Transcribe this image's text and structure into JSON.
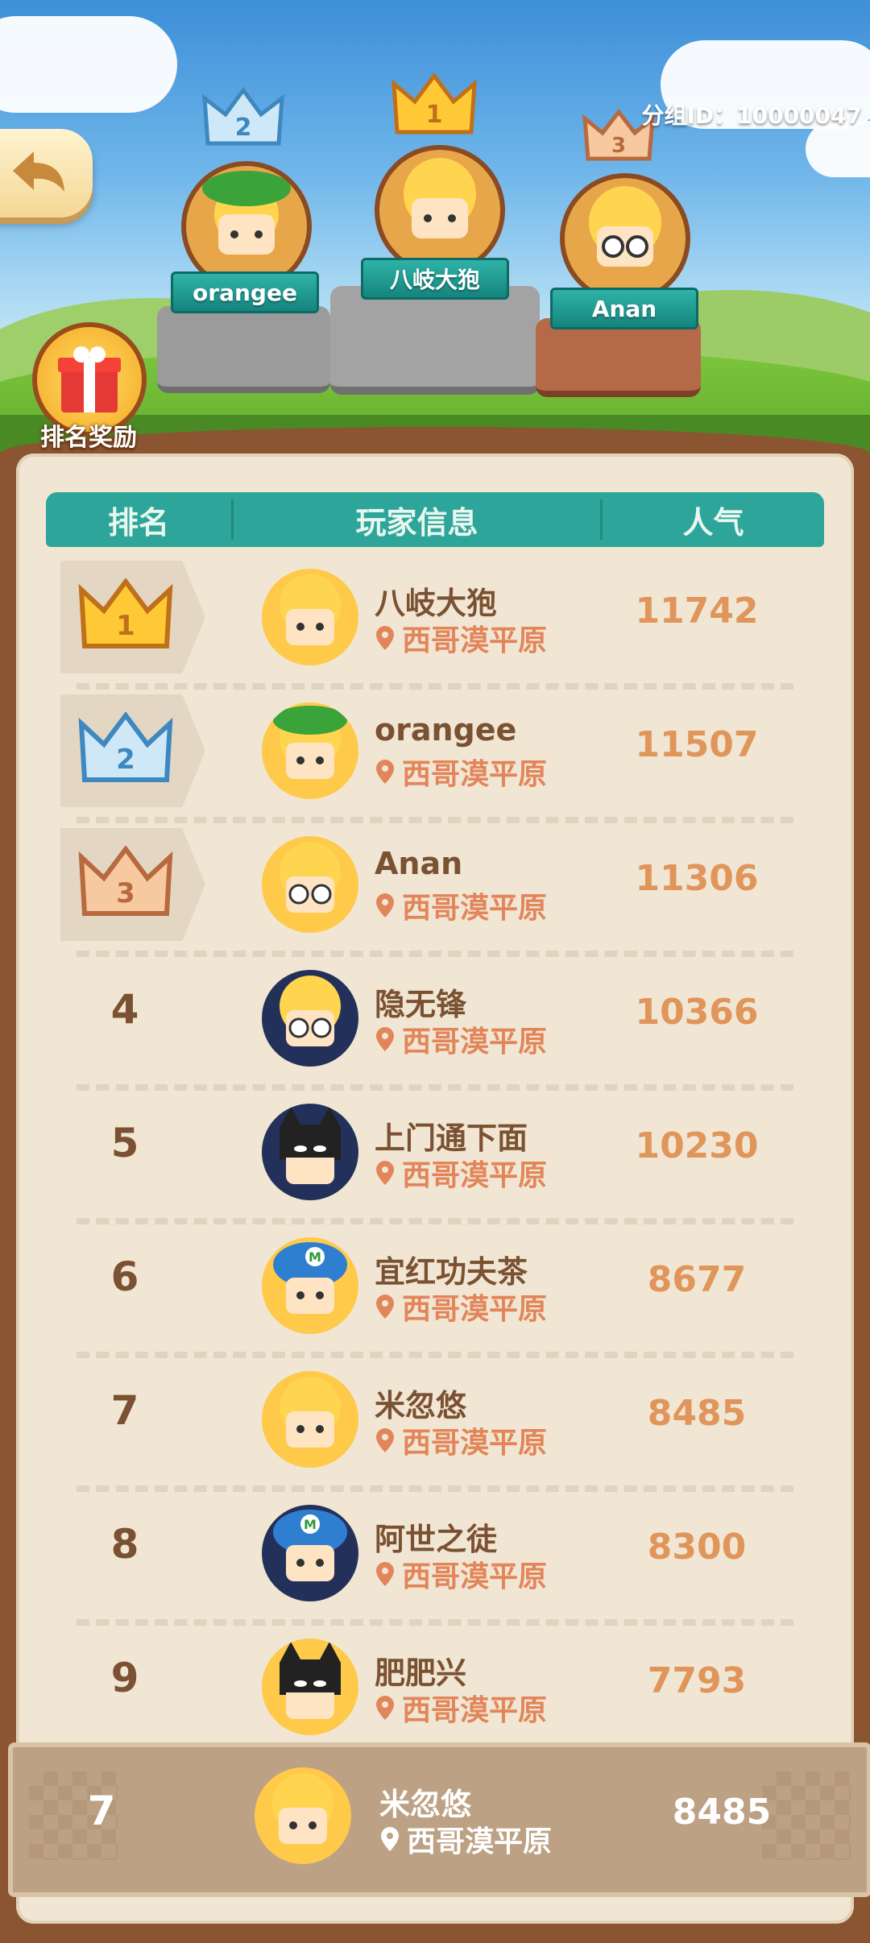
{
  "header_top": {
    "group_id": "分组ID：10000047"
  },
  "podium": [
    {
      "place": 2,
      "name": "orangee"
    },
    {
      "place": 1,
      "name": "八岐大狍"
    },
    {
      "place": 3,
      "name": "Anan"
    }
  ],
  "reward": {
    "label": "排名奖励"
  },
  "table": {
    "headers": {
      "rank": "排名",
      "player": "玩家信息",
      "popularity": "人气"
    },
    "rows": [
      {
        "rank": "1",
        "name": "八岐大狍",
        "location": "西哥漠平原",
        "score": "11742"
      },
      {
        "rank": "2",
        "name": "orangee",
        "location": "西哥漠平原",
        "score": "11507"
      },
      {
        "rank": "3",
        "name": "Anan",
        "location": "西哥漠平原",
        "score": "11306"
      },
      {
        "rank": "4",
        "name": "隐无锋",
        "location": "西哥漠平原",
        "score": "10366"
      },
      {
        "rank": "5",
        "name": "上门通下面",
        "location": "西哥漠平原",
        "score": "10230"
      },
      {
        "rank": "6",
        "name": "宜红功夫茶",
        "location": "西哥漠平原",
        "score": "8677"
      },
      {
        "rank": "7",
        "name": "米忽悠",
        "location": "西哥漠平原",
        "score": "8485"
      },
      {
        "rank": "8",
        "name": "阿世之徒",
        "location": "西哥漠平原",
        "score": "8300"
      },
      {
        "rank": "9",
        "name": "肥肥兴",
        "location": "西哥漠平原",
        "score": "7793"
      }
    ]
  },
  "my_rank": {
    "rank": "7",
    "name": "米忽悠",
    "location": "西哥漠平原",
    "score": "8485"
  },
  "colors": {
    "teal": "#2ea59a",
    "panel": "#f1e6d3",
    "text_brown": "#7a5132",
    "score_orange": "#e0955b"
  }
}
